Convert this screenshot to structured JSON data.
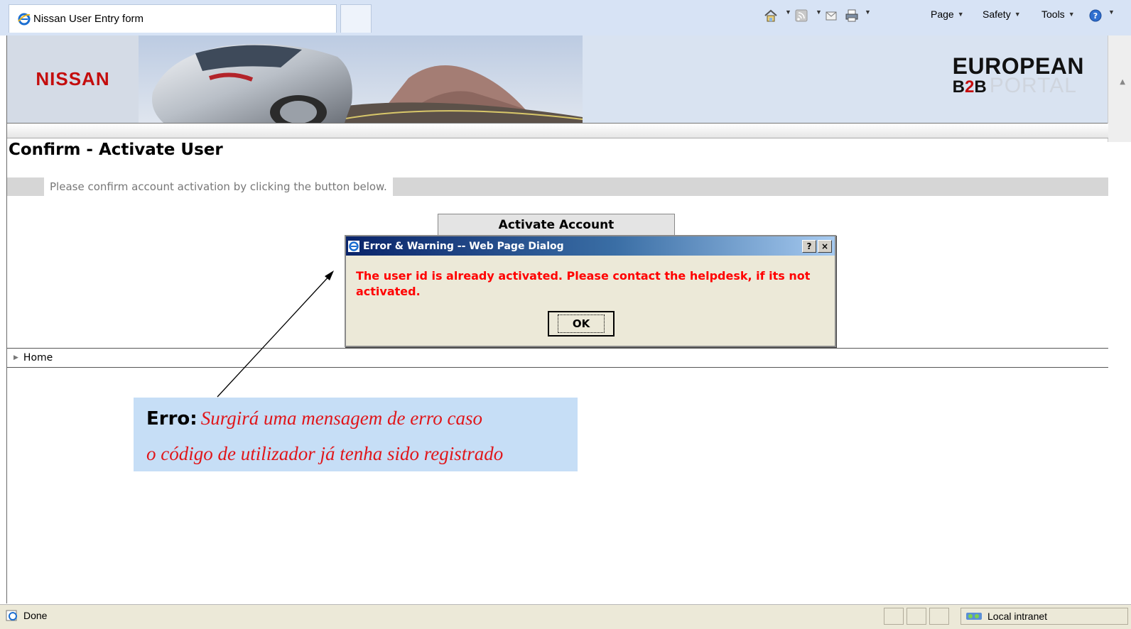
{
  "browser": {
    "tab_title": "Nissan User Entry form",
    "commands": {
      "page": "Page",
      "safety": "Safety",
      "tools": "Tools"
    }
  },
  "banner": {
    "logo_text": "NISSAN",
    "portal_line1": "EUROPEAN",
    "portal_b": "B",
    "portal_2": "2",
    "portal_b2": "B",
    "portal_word": "PORTAL"
  },
  "page": {
    "title": "Confirm - Activate User",
    "instruction": "Please confirm account activation by clicking the button below.",
    "activate_button": "Activate Account",
    "home_link": "Home"
  },
  "dialog": {
    "title": "Error & Warning -- Web Page Dialog",
    "help_button": "?",
    "close_button": "×",
    "message": "The user id is already activated. Please contact the helpdesk, if its not activated.",
    "ok_button": "OK"
  },
  "annotation": {
    "lead": "Erro:",
    "line1": "Surgirá uma mensagem de erro caso",
    "line2": "o código de utilizador já tenha sido registrado"
  },
  "statusbar": {
    "status": "Done",
    "zone": "Local intranet"
  },
  "colors": {
    "nissan_red": "#c40d0d",
    "error_red": "#ff0000",
    "dialog_title_blue": "#0a246a",
    "callout_bg": "#c6def6",
    "annotation_red": "#e0161a"
  }
}
